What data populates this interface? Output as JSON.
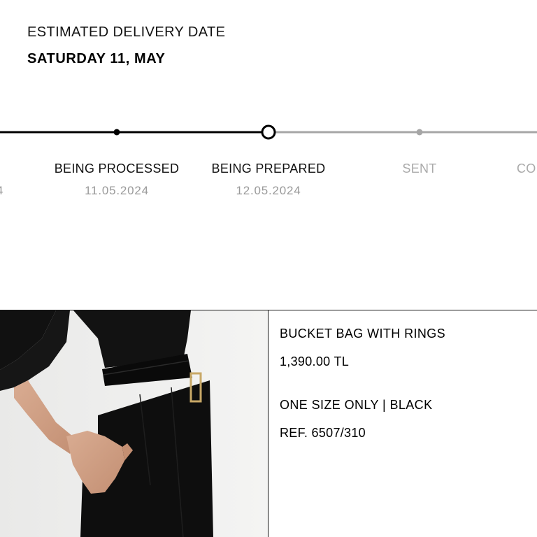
{
  "delivery": {
    "label": "ESTIMATED DELIVERY DATE",
    "date": "SATURDAY 11, MAY"
  },
  "timeline": {
    "steps": [
      {
        "label": "",
        "date": "4",
        "state": "done"
      },
      {
        "label": "BEING PROCESSED",
        "date": "11.05.2024",
        "state": "done"
      },
      {
        "label": "BEING PREPARED",
        "date": "12.05.2024",
        "state": "current"
      },
      {
        "label": "SENT",
        "date": "",
        "state": "pending"
      },
      {
        "label": "CO",
        "date": "",
        "state": "pending"
      }
    ],
    "colors": {
      "done": "#000000",
      "pending": "#a6a6a6"
    }
  },
  "product": {
    "name": "BUCKET BAG WITH RINGS",
    "price": "1,390.00 TL",
    "variant": "ONE SIZE ONLY | BLACK",
    "ref": "REF. 6507/310",
    "image_alt": "model-wearing-black-outfit-photo"
  }
}
